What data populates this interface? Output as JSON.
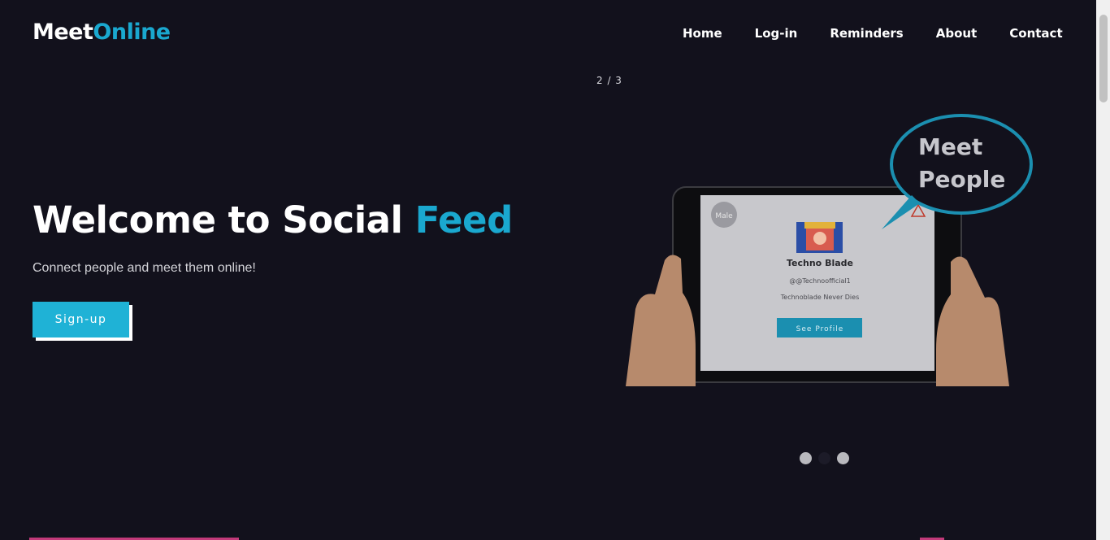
{
  "brand": {
    "part1": "Meet",
    "part2": "Online"
  },
  "nav": [
    {
      "label": "Home"
    },
    {
      "label": "Log-in"
    },
    {
      "label": "Reminders"
    },
    {
      "label": "About"
    },
    {
      "label": "Contact"
    }
  ],
  "slider": {
    "counter": "2 / 3",
    "active_index": 2,
    "total": 3
  },
  "hero": {
    "title_main": "Welcome to Social ",
    "title_accent": "Feed",
    "subtitle": "Connect people and meet them online!",
    "button_label": "Sign-up"
  },
  "illustration": {
    "bubble_line1": "Meet",
    "bubble_line2": "People",
    "badge": "Male",
    "profile_name": "Techno Blade",
    "profile_handle": "@@Technoofficial1",
    "profile_bio": "Technoblade Never Dies",
    "profile_button": "See Profile"
  },
  "colors": {
    "background": "#12111c",
    "accent": "#1aa8cf",
    "button": "#1fb2d6"
  }
}
